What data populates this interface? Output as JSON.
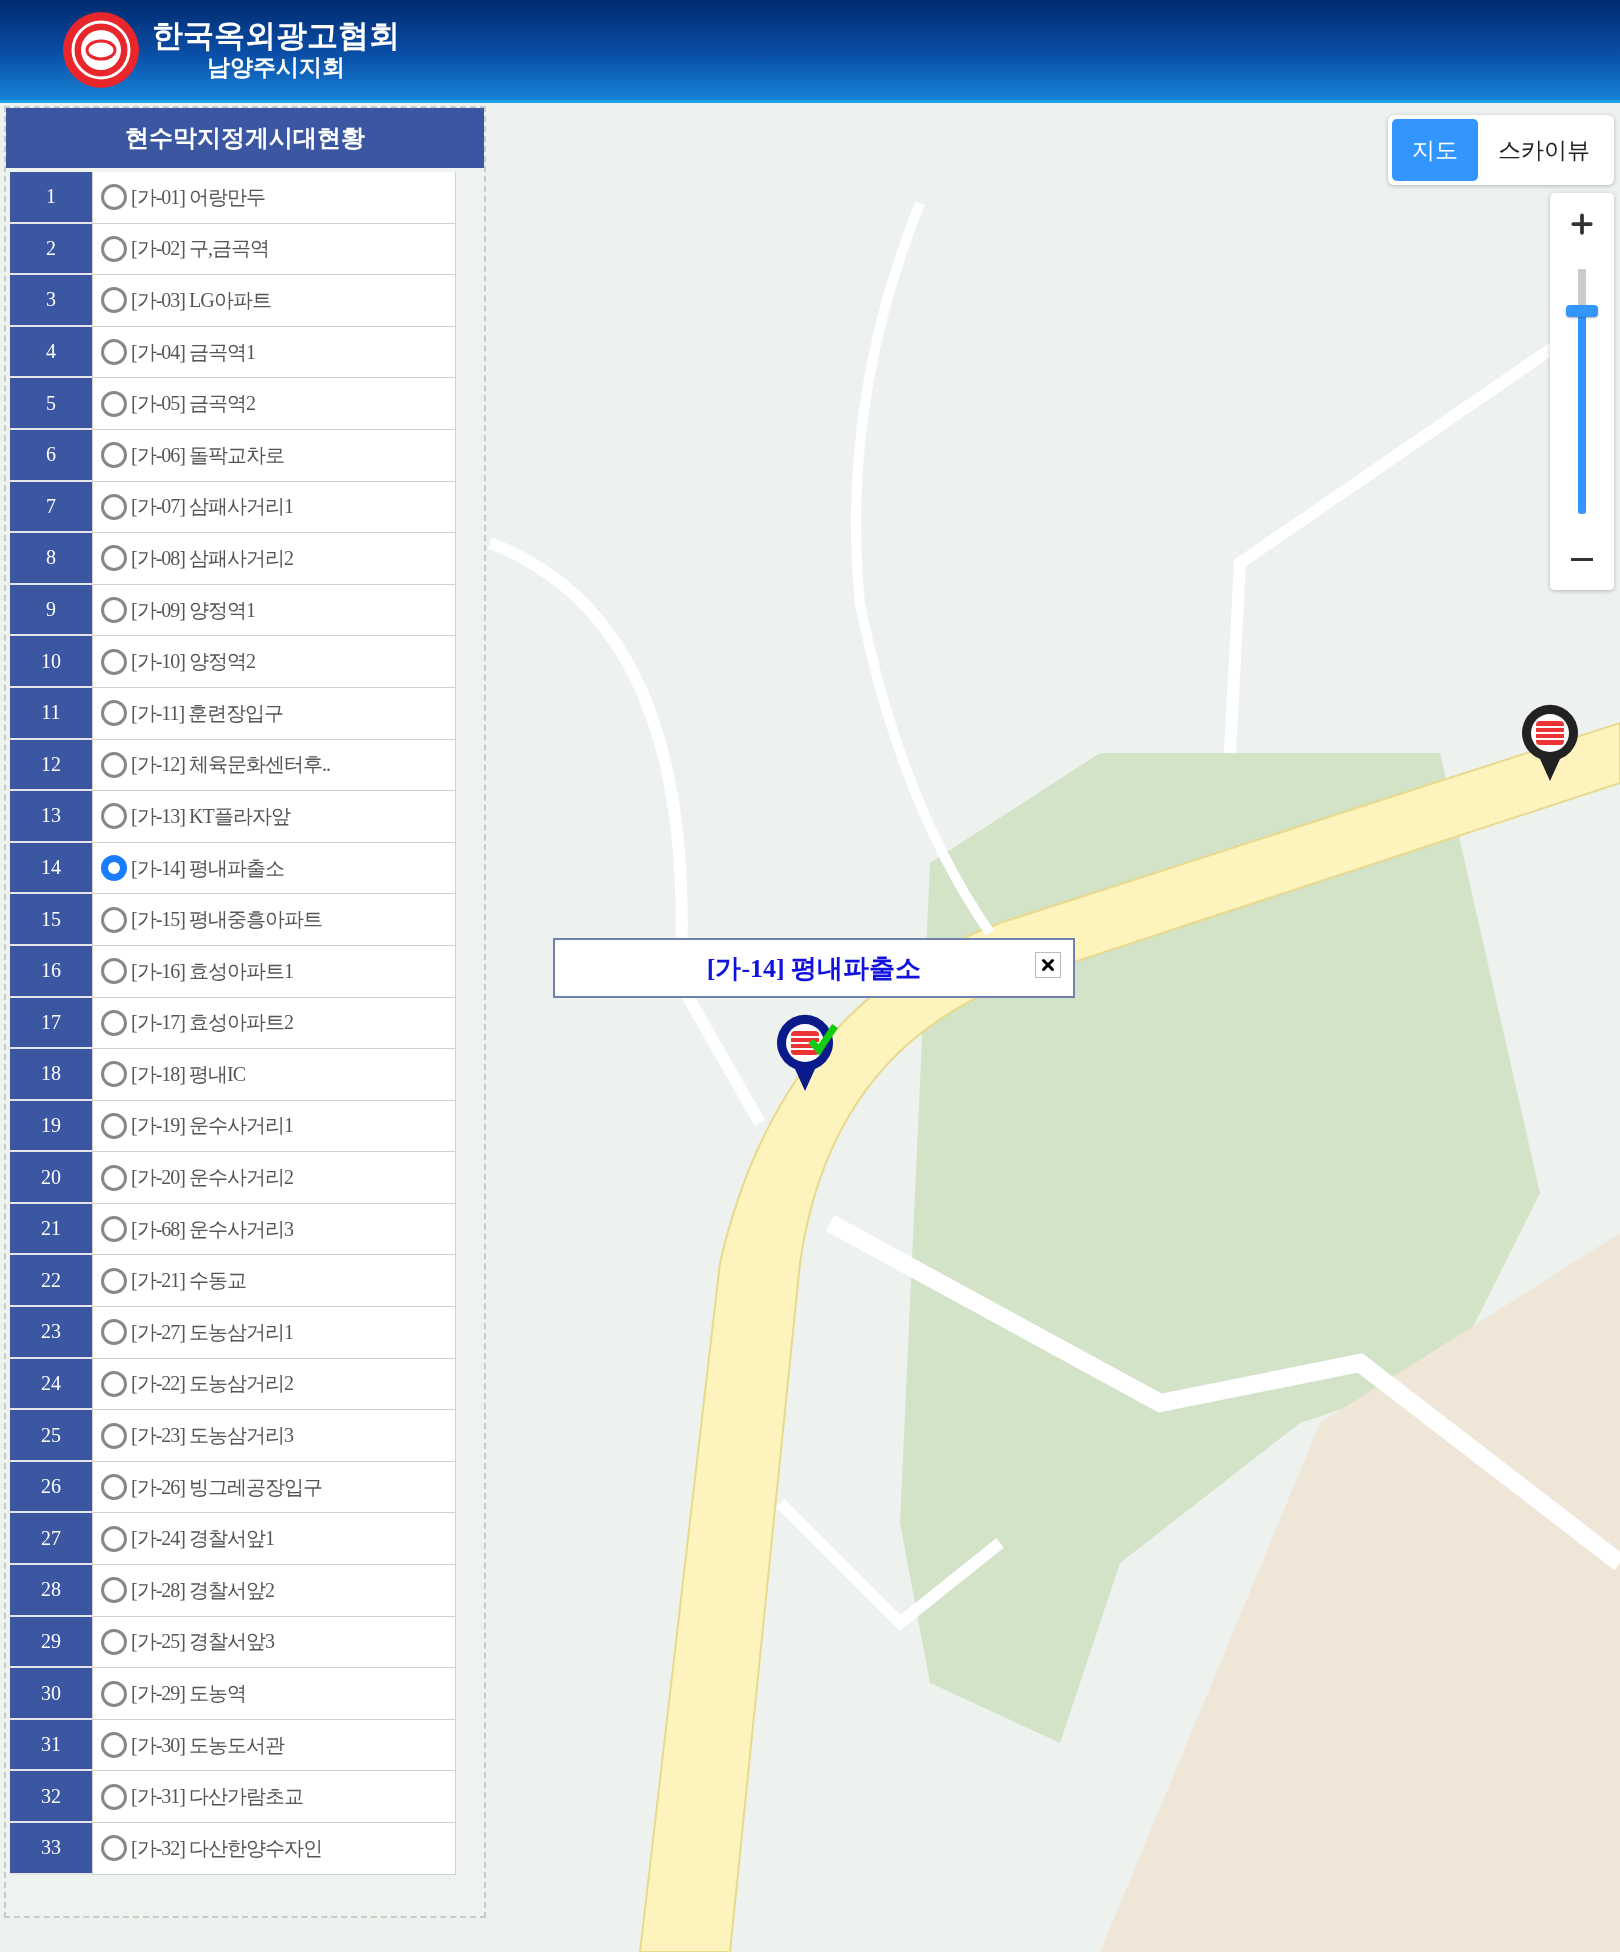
{
  "header": {
    "title": "한국옥외광고협회",
    "subtitle": "남양주시지회"
  },
  "sidebar": {
    "title": "현수막지정게시대현황",
    "items": [
      {
        "number": "1",
        "label": "[가-01] 어랑만두",
        "selected": false
      },
      {
        "number": "2",
        "label": "[가-02] 구,금곡역",
        "selected": false
      },
      {
        "number": "3",
        "label": "[가-03] LG아파트",
        "selected": false
      },
      {
        "number": "4",
        "label": "[가-04] 금곡역1",
        "selected": false
      },
      {
        "number": "5",
        "label": "[가-05] 금곡역2",
        "selected": false
      },
      {
        "number": "6",
        "label": "[가-06] 돌팍교차로",
        "selected": false
      },
      {
        "number": "7",
        "label": "[가-07] 삼패사거리1",
        "selected": false
      },
      {
        "number": "8",
        "label": "[가-08] 삼패사거리2",
        "selected": false
      },
      {
        "number": "9",
        "label": "[가-09] 양정역1",
        "selected": false
      },
      {
        "number": "10",
        "label": "[가-10] 양정역2",
        "selected": false
      },
      {
        "number": "11",
        "label": "[가-11] 훈련장입구",
        "selected": false
      },
      {
        "number": "12",
        "label": "[가-12] 체육문화센터후..",
        "selected": false
      },
      {
        "number": "13",
        "label": "[가-13] KT플라자앞",
        "selected": false
      },
      {
        "number": "14",
        "label": "[가-14] 평내파출소",
        "selected": true
      },
      {
        "number": "15",
        "label": "[가-15] 평내중흥아파트",
        "selected": false
      },
      {
        "number": "16",
        "label": "[가-16] 효성아파트1",
        "selected": false
      },
      {
        "number": "17",
        "label": "[가-17] 효성아파트2",
        "selected": false
      },
      {
        "number": "18",
        "label": "[가-18] 평내IC",
        "selected": false
      },
      {
        "number": "19",
        "label": "[가-19] 운수사거리1",
        "selected": false
      },
      {
        "number": "20",
        "label": "[가-20] 운수사거리2",
        "selected": false
      },
      {
        "number": "21",
        "label": "[가-68] 운수사거리3",
        "selected": false
      },
      {
        "number": "22",
        "label": "[가-21] 수동교",
        "selected": false
      },
      {
        "number": "23",
        "label": "[가-27] 도농삼거리1",
        "selected": false
      },
      {
        "number": "24",
        "label": "[가-22] 도농삼거리2",
        "selected": false
      },
      {
        "number": "25",
        "label": "[가-23] 도농삼거리3",
        "selected": false
      },
      {
        "number": "26",
        "label": "[가-26] 빙그레공장입구",
        "selected": false
      },
      {
        "number": "27",
        "label": "[가-24] 경찰서앞1",
        "selected": false
      },
      {
        "number": "28",
        "label": "[가-28] 경찰서앞2",
        "selected": false
      },
      {
        "number": "29",
        "label": "[가-25] 경찰서앞3",
        "selected": false
      },
      {
        "number": "30",
        "label": "[가-29] 도농역",
        "selected": false
      },
      {
        "number": "31",
        "label": "[가-30] 도농도서관",
        "selected": false
      },
      {
        "number": "32",
        "label": "[가-31] 다산가람초교",
        "selected": false
      },
      {
        "number": "33",
        "label": "[가-32] 다산한양수자인",
        "selected": false
      }
    ]
  },
  "map": {
    "type_buttons": [
      {
        "label": "지도",
        "selected": true
      },
      {
        "label": "스카이뷰",
        "selected": false
      }
    ],
    "zoom": {
      "level": 0.83
    },
    "popup": {
      "title": "[가-14] 평내파출소"
    }
  }
}
